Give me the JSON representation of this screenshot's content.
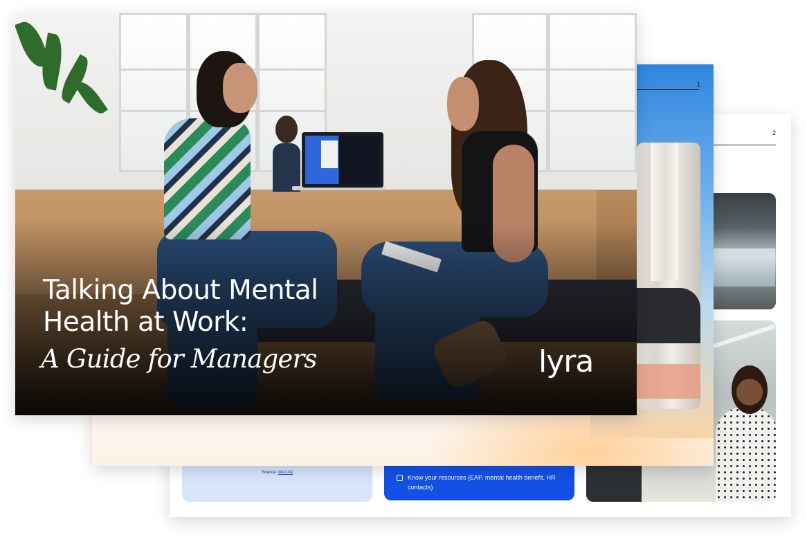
{
  "back_page": {
    "page_number": "2",
    "source_prefix": "Source: ",
    "source_link": "MetLife",
    "checklist_item": "Know your resources (EAP, mental health benefit, HR contacts)"
  },
  "middle_page": {
    "page_number": "1"
  },
  "cover": {
    "title_line1": "Talking About Mental",
    "title_line2": "Health at Work:",
    "subtitle": "A Guide for Managers",
    "logo": "lyra"
  },
  "colors": {
    "brand_blue": "#1350e6",
    "light_blue_card": "#d8e6fb",
    "sky_gradient_top": "#2f86e0",
    "warm_glow": "#ffcf96"
  }
}
